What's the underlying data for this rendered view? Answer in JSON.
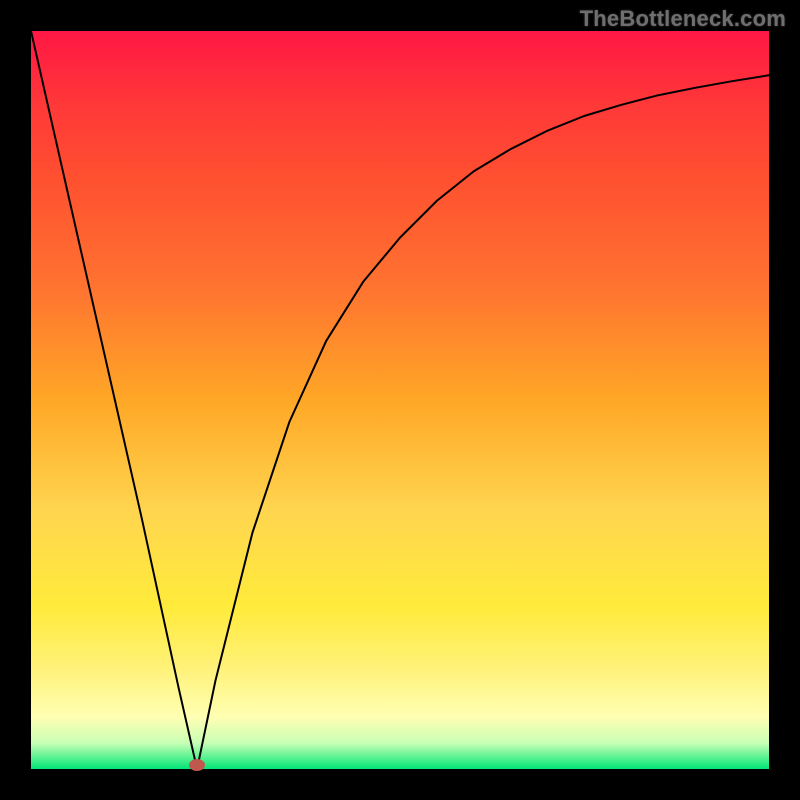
{
  "watermark": "TheBottleneck.com",
  "chart_data": {
    "type": "line",
    "title": "",
    "xlabel": "",
    "ylabel": "",
    "xlim": [
      0,
      100
    ],
    "ylim": [
      0,
      100
    ],
    "grid": false,
    "legend": false,
    "marker": {
      "x": 22.5,
      "y": 0.5,
      "color": "#c0584e"
    },
    "background_gradient": {
      "top": "#ff1744",
      "middle": "#ffd54f",
      "bottom": "#00e676",
      "direction": "vertical"
    },
    "series": [
      {
        "name": "bottleneck-curve",
        "x": [
          0,
          5,
          10,
          15,
          20,
          22.5,
          25,
          30,
          35,
          40,
          45,
          50,
          55,
          60,
          65,
          70,
          75,
          80,
          85,
          90,
          95,
          100
        ],
        "y": [
          100,
          78,
          56,
          34,
          11,
          0,
          12,
          32,
          47,
          58,
          66,
          72,
          77,
          81,
          84,
          86.5,
          88.5,
          90,
          91.3,
          92.3,
          93.2,
          94
        ]
      }
    ]
  }
}
